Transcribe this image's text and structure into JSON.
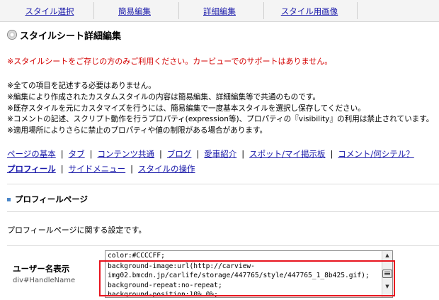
{
  "tabs": [
    "スタイル選択",
    "簡易編集",
    "詳細編集",
    "スタイル用画像"
  ],
  "page_title": "スタイルシート詳細編集",
  "red_note": "※スタイルシートをご存じの方のみご利用ください。カービューでのサポートはありません。",
  "notes": [
    "※全ての項目を記述する必要はありません。",
    "※編集により作成されたカスタムスタイルの内容は簡易編集、詳細編集等で共通のものです。",
    "※既存スタイルを元にカスタマイズを行うには、簡易編集で一度基本スタイルを選択し保存してください。",
    "※コメントの記述、スクリプト動作を行うプロパティ(expression等)、プロパティの『visibility』の利用は禁止されています。",
    "※適用場所によりさらに禁止のプロパティや値の制限がある場合があります。"
  ],
  "nav_links": [
    "ページの基本",
    "タブ",
    "コンテンツ共通",
    "ブログ",
    "愛車紹介",
    "スポット/マイ掲示板",
    "コメント/何シテル？",
    "プロフィール",
    "サイドメニュー",
    "スタイルの操作"
  ],
  "nav_separator": "|",
  "section_title": "プロフィールページ",
  "section_desc": "プロフィールページに関する設定です。",
  "field": {
    "label": "ユーザー名表示",
    "id": "div#HandleName",
    "lines": [
      "color:#CCCCFF;",
      "background-image:url(http://carview-",
      "img02.bmcdn.jp/carlife/storage/447765/style/447765_1_8b425.gif);",
      "background-repeat:no-repeat;",
      "background-position:10% 0%;"
    ]
  },
  "colors": {
    "accent_link": "#1a1aaa",
    "note_red": "#d40000",
    "highlight": "#e8141e"
  }
}
